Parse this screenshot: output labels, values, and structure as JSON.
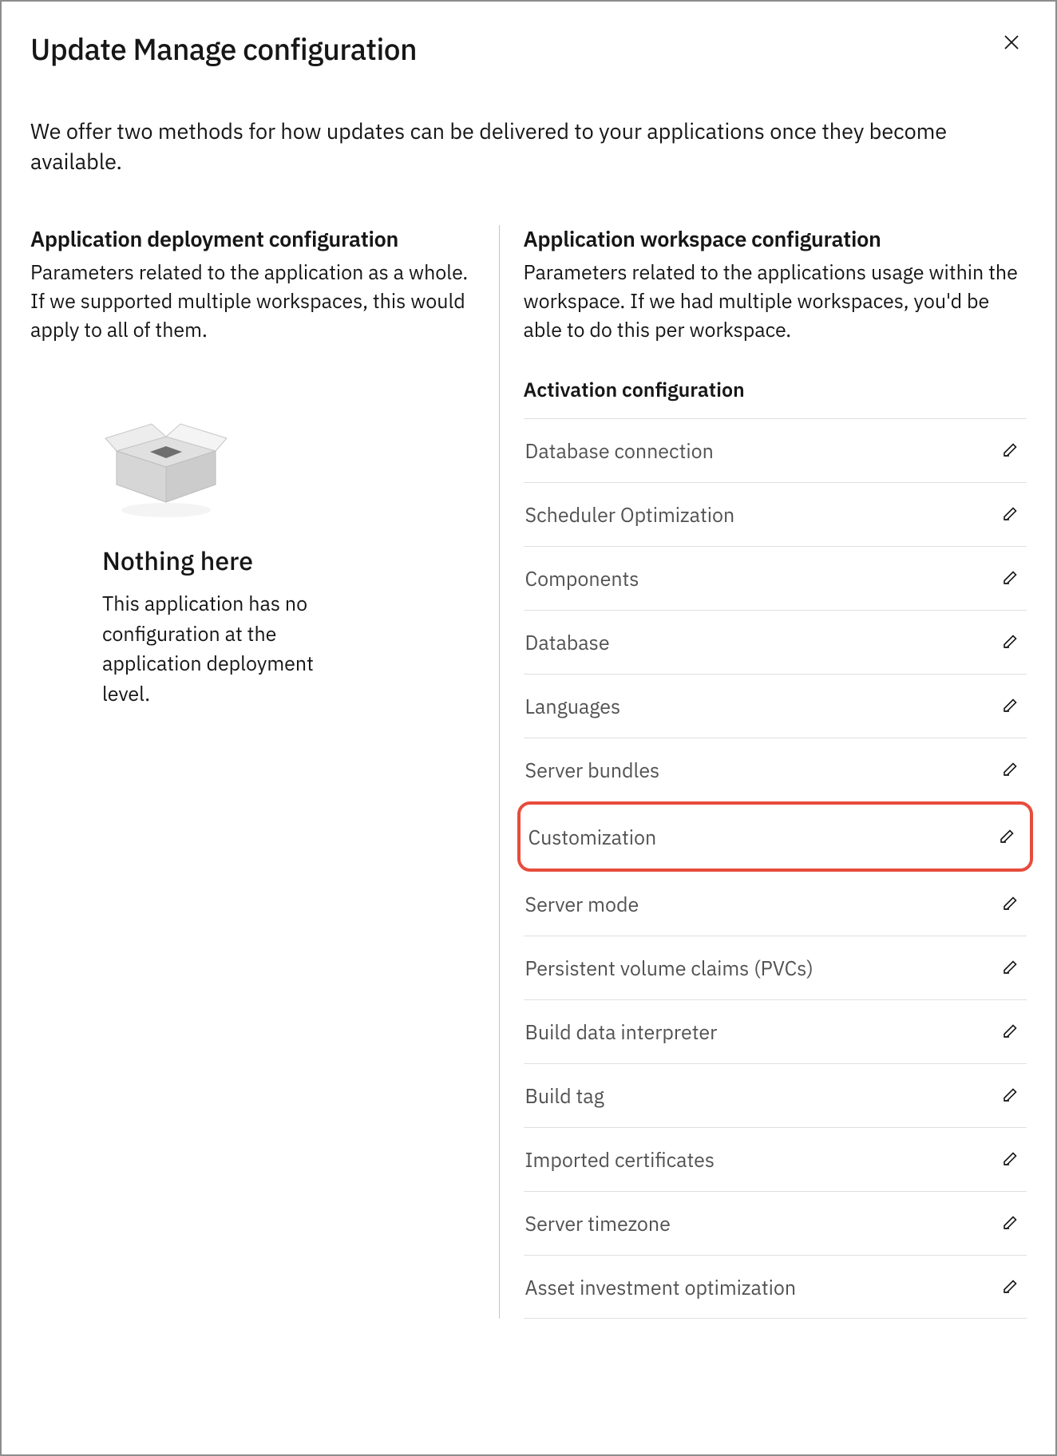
{
  "dialog": {
    "title": "Update Manage configuration",
    "intro": "We offer two methods for how updates can be delivered to your applications once they become available."
  },
  "left": {
    "title": "Application deployment configuration",
    "desc": "Parameters related to the application as a whole. If we supported multiple workspaces, this would apply to all of them.",
    "empty_title": "Nothing here",
    "empty_desc": "This application has no configuration at the application deployment level."
  },
  "right": {
    "title": "Application workspace configuration",
    "desc": "Parameters related to the applications usage within the workspace. If we had multiple workspaces, you'd be able to do this per workspace.",
    "subhead": "Activation configuration",
    "rows": [
      {
        "label": "Database connection"
      },
      {
        "label": "Scheduler Optimization"
      },
      {
        "label": "Components"
      },
      {
        "label": "Database"
      },
      {
        "label": "Languages"
      },
      {
        "label": "Server bundles"
      },
      {
        "label": "Customization",
        "highlighted": true
      },
      {
        "label": "Server mode"
      },
      {
        "label": "Persistent volume claims (PVCs)"
      },
      {
        "label": "Build data interpreter"
      },
      {
        "label": "Build tag"
      },
      {
        "label": "Imported certificates"
      },
      {
        "label": "Server timezone"
      },
      {
        "label": "Asset investment optimization"
      }
    ]
  }
}
